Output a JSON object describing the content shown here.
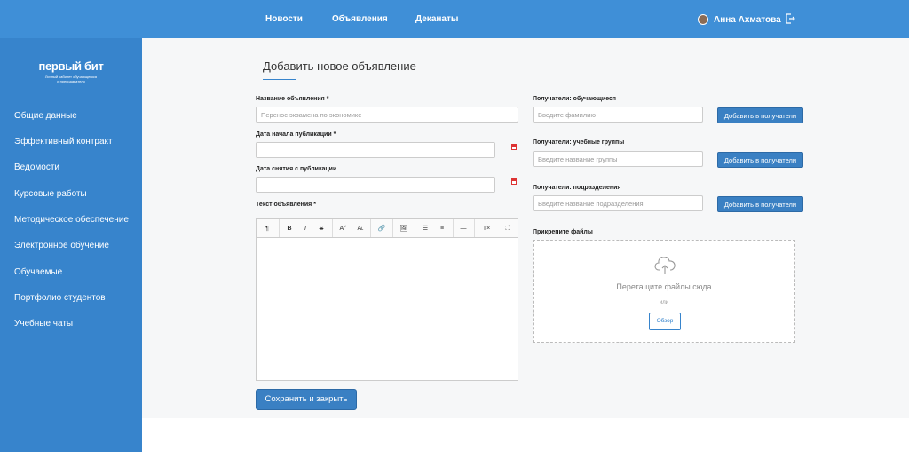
{
  "topnav": {
    "items": [
      "Новости",
      "Объявления",
      "Деканаты"
    ],
    "user_name": "Анна Ахматова"
  },
  "logo": {
    "title": "первый бит",
    "subtitle_line1": "Личный кабинет обучающегося",
    "subtitle_line2": "и преподавателя"
  },
  "sidebar": {
    "items": [
      "Общие данные",
      "Эффективный контракт",
      "Ведомости",
      "Курсовые работы",
      "Методическое обеспечение",
      "Электронное обучение",
      "Обучаемые",
      "Портфолио студентов",
      "Учебные чаты"
    ]
  },
  "page": {
    "title": "Добавить новое объявление"
  },
  "form": {
    "name_label": "Название объявления *",
    "name_placeholder": "Перенос экзамена по экономике",
    "start_label": "Дата начала публикации *",
    "end_label": "Дата снятия с публикации",
    "text_label": "Текст объявления *",
    "students_label": "Получатели: обучающиеся",
    "students_placeholder": "Введите фамилию",
    "groups_label": "Получатели: учебные группы",
    "groups_placeholder": "Введите название группы",
    "depts_label": "Получатели: подразделения",
    "depts_placeholder": "Введите название подразделения",
    "add_button": "Добавить в получатели",
    "files_label": "Прикрепите файлы",
    "drop_text": "Перетащите файлы сюда",
    "or_text": "или",
    "browse_button": "Обзор",
    "save_button": "Сохранить и закрыть"
  },
  "toolbar": {
    "paragraph": "¶",
    "bold": "B",
    "italic": "I",
    "strike": "S",
    "superscript": "A˟",
    "subscript": "A˪",
    "link": "🔗",
    "image": "🖼",
    "bullet_list": "☰",
    "ordered_list": "≡",
    "hr": "—",
    "clear_format": "T×",
    "fullscreen": "⛶"
  },
  "colors": {
    "topbar": "#3f8fd7",
    "sidebar": "#3784cc",
    "primary_button": "#3a80c3",
    "background": "#f6f7f8"
  }
}
